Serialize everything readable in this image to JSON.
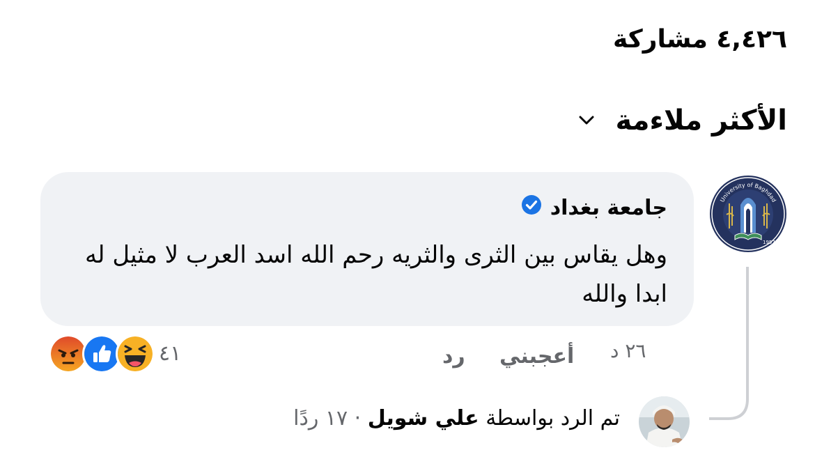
{
  "post": {
    "shares_label": "٤,٤٢٦ مشاركة"
  },
  "sort": {
    "label": "الأكثر ملاءمة",
    "icon": "chevron-down-icon"
  },
  "comment": {
    "author": "جامعة  بغداد",
    "verified_icon": "verified-badge-icon",
    "text": "وهل يقاس بين الثرى والثريه رحم الله اسد العرب لا مثيل له ابدا والله",
    "time": "٢٦ د",
    "like_label": "أعجبني",
    "reply_label": "رد",
    "reaction_count": "٤١",
    "reactions": [
      "angry-icon",
      "like-icon",
      "haha-icon"
    ],
    "avatar_logo": {
      "top_text": "University of Baghdad",
      "year_text": "1957",
      "arabic_text": "بغداد"
    }
  },
  "replies": {
    "prefix": "تم الرد بواسطة",
    "replier": "علي شويل",
    "separator": "·",
    "count": "١٧ ردًا"
  },
  "colors": {
    "bubble": "#f0f2f5",
    "secondary_text": "#65676b",
    "verified": "#1b74e4",
    "like": "#1877f2",
    "haha": "#f7b125",
    "angry": "#e9710f"
  }
}
